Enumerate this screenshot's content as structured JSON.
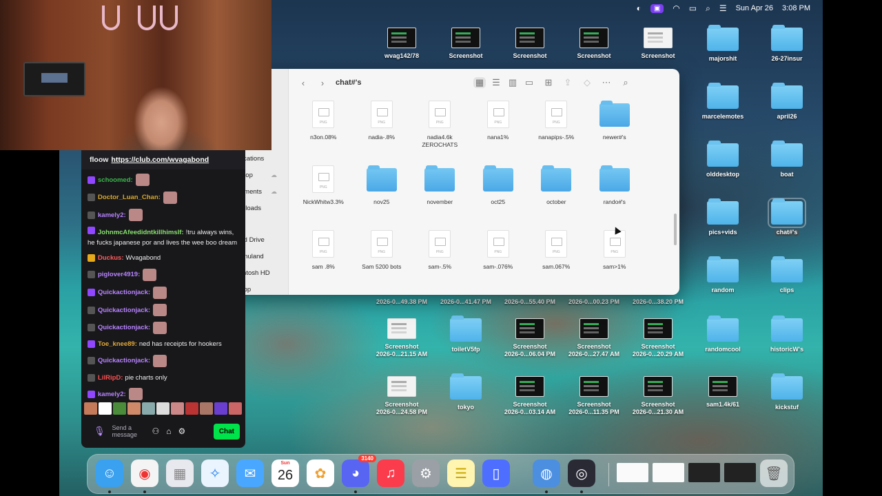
{
  "menubar": {
    "date": "Sun Apr 26",
    "time": "3:08 PM",
    "icons": [
      "globe-icon",
      "screen-record-icon",
      "wifi-icon",
      "battery-icon",
      "search-icon",
      "control-center-icon"
    ]
  },
  "desktop": {
    "items": [
      {
        "kind": "thumb",
        "label": "wvag142/78"
      },
      {
        "kind": "thumb",
        "label": "Screenshot"
      },
      {
        "kind": "thumb",
        "label": "Screenshot"
      },
      {
        "kind": "thumb",
        "label": "Screenshot"
      },
      {
        "kind": "thumb-light",
        "label": "Screenshot"
      },
      {
        "kind": "folder",
        "label": "majorshit"
      },
      {
        "kind": "folder",
        "label": "26-27insur"
      },
      {
        "kind": "folder",
        "label": "marcelemotes"
      },
      {
        "kind": "folder",
        "label": "april26"
      },
      {
        "kind": "folder",
        "label": "olddesktop"
      },
      {
        "kind": "folder",
        "label": "boat"
      },
      {
        "kind": "folder",
        "label": "pics+vids"
      },
      {
        "kind": "folder",
        "label": "chat#'s"
      },
      {
        "kind": "folder",
        "label": "random"
      },
      {
        "kind": "folder",
        "label": "clips"
      },
      {
        "kind": "timestamp",
        "label": "2026-0...49.38 PM"
      },
      {
        "kind": "timestamp",
        "label": "2026-0...41.47 PM"
      },
      {
        "kind": "timestamp",
        "label": "2026-0...55.40 PM"
      },
      {
        "kind": "timestamp",
        "label": "2026-0...00.23 PM"
      },
      {
        "kind": "timestamp",
        "label": "2026-0...38.20 PM"
      },
      {
        "kind": "thumb-light",
        "label": "Screenshot",
        "sub": "2026-0...21.15 AM"
      },
      {
        "kind": "folder",
        "label": "toiletV5fp"
      },
      {
        "kind": "thumb",
        "label": "Screenshot",
        "sub": "2026-0...06.04 PM"
      },
      {
        "kind": "thumb",
        "label": "Screenshot",
        "sub": "2026-0...27.47 AM"
      },
      {
        "kind": "thumb",
        "label": "Screenshot",
        "sub": "2026-0...20.29 AM"
      },
      {
        "kind": "folder",
        "label": "randomcool"
      },
      {
        "kind": "folder",
        "label": "historicW's"
      },
      {
        "kind": "thumb-light",
        "label": "Screenshot",
        "sub": "2026-0...24.58 PM"
      },
      {
        "kind": "folder",
        "label": "tokyo"
      },
      {
        "kind": "thumb",
        "label": "Screenshot",
        "sub": "2026-0...03.14 AM"
      },
      {
        "kind": "thumb",
        "label": "Screenshot",
        "sub": "2026-0...11.35 PM"
      },
      {
        "kind": "thumb",
        "label": "Screenshot",
        "sub": "2026-0...21.30 AM"
      },
      {
        "kind": "thumb",
        "label": "sam1.4k/61"
      },
      {
        "kind": "folder",
        "label": "kickstuf"
      },
      {
        "kind": "partial",
        "label": "PM"
      },
      {
        "kind": "partial",
        "label": "PM"
      },
      {
        "kind": "partial",
        "label": "PM"
      }
    ]
  },
  "finder": {
    "title": "chat#'s",
    "sidebar": {
      "items": [
        {
          "icon": "applications-icon",
          "label": "Applications"
        },
        {
          "icon": "desktop-icon",
          "label": "Desktop",
          "cloud": true
        },
        {
          "icon": "documents-icon",
          "label": "Documents",
          "cloud": true
        },
        {
          "icon": "downloads-icon",
          "label": "Downloads"
        }
      ],
      "locations_header": "Locations",
      "locations": [
        {
          "icon": "icloud-icon",
          "label": "iCloud Drive"
        },
        {
          "icon": "home-icon",
          "label": "justinnuland"
        },
        {
          "icon": "disk-icon",
          "label": "Macintosh HD"
        },
        {
          "icon": "airdrop-icon",
          "label": "AirDrop"
        }
      ]
    },
    "files": [
      {
        "kind": "png",
        "name": "n3on.08%"
      },
      {
        "kind": "png",
        "name": "nadia-.8%"
      },
      {
        "kind": "png",
        "name": "nadia4.6k ZEROCHATS"
      },
      {
        "kind": "png",
        "name": "nana1%"
      },
      {
        "kind": "png",
        "name": "nanapips-.5%"
      },
      {
        "kind": "folder",
        "name": "newer#'s"
      },
      {
        "kind": "png",
        "name": "NickWhitw3.3%"
      },
      {
        "kind": "folder",
        "name": "nov25"
      },
      {
        "kind": "folder",
        "name": "november"
      },
      {
        "kind": "folder",
        "name": "oct25"
      },
      {
        "kind": "folder",
        "name": "october"
      },
      {
        "kind": "folder",
        "name": "rando#'s"
      },
      {
        "kind": "png",
        "name": "sam .8%"
      },
      {
        "kind": "png",
        "name": "Sam 5200 bots"
      },
      {
        "kind": "png",
        "name": "sam-.5%"
      },
      {
        "kind": "png",
        "name": "sam-.076%"
      },
      {
        "kind": "png",
        "name": "sam.067%"
      },
      {
        "kind": "png",
        "name": "sam>1%"
      }
    ]
  },
  "chat": {
    "pinned_prefix": "floow",
    "pinned_link": "https://club.com/wvagabond",
    "messages": [
      {
        "user": "schoomed:",
        "color": "#3bb54a",
        "text": "",
        "emote": true
      },
      {
        "user": "Doctor_Luan_Chan:",
        "color": "#d9a92b",
        "text": "",
        "emote": true
      },
      {
        "user": "kamely2:",
        "color": "#b883ff",
        "text": "",
        "emote": true
      },
      {
        "user": "JohnmcAfeedidntkillhimslf:",
        "color": "#88e06d",
        "text": "!tru always wins, he fucks japanese por and lives the wee boo dream",
        "wrap": true
      },
      {
        "user": "Duckus:",
        "color": "#ff5a5a",
        "text": "Wvagabond"
      },
      {
        "user": "piglover4919:",
        "color": "#b883ff",
        "text": "",
        "emote": true
      },
      {
        "user": "Quickactionjack:",
        "color": "#b883ff",
        "text": "",
        "emote": true
      },
      {
        "user": "Quickactionjack:",
        "color": "#b883ff",
        "text": "",
        "emote": true
      },
      {
        "user": "Quickactionjack:",
        "color": "#b883ff",
        "text": "",
        "emote": true
      },
      {
        "user": "Toe_knee89:",
        "color": "#e0a93a",
        "text": "ned has receipts for hookers"
      },
      {
        "user": "Quickactionjack:",
        "color": "#b883ff",
        "text": "",
        "emote": true
      },
      {
        "user": "LilRipD:",
        "color": "#ff4f4f",
        "text": "pie charts only"
      },
      {
        "user": "kamely2:",
        "color": "#b883ff",
        "text": "",
        "emote": true
      }
    ],
    "input_placeholder": "Send a message",
    "send_label": "Chat"
  },
  "dock": {
    "apps": [
      {
        "name": "finder-icon",
        "bg": "#3aa0f0"
      },
      {
        "name": "chrome-icon",
        "bg": "#f4f4f4"
      },
      {
        "name": "launchpad-icon",
        "bg": "#e8e8ef"
      },
      {
        "name": "safari-icon",
        "bg": "#eaf4ff"
      },
      {
        "name": "mail-icon",
        "bg": "#4aa7ff"
      },
      {
        "name": "calendar-icon",
        "bg": "#ffffff"
      },
      {
        "name": "photos-icon",
        "bg": "#ffffff"
      },
      {
        "name": "discord-icon",
        "bg": "#5865f2"
      },
      {
        "name": "music-icon",
        "bg": "#fb3c4c"
      },
      {
        "name": "settings-icon",
        "bg": "#9aa0a6"
      },
      {
        "name": "notes-icon",
        "bg": "#fff4b0"
      },
      {
        "name": "iphone-mirroring-icon",
        "bg": "#4e6eff"
      },
      {
        "name": "app-icon",
        "bg": "#4c8fe0"
      },
      {
        "name": "obs-icon",
        "bg": "#2a2a35"
      }
    ],
    "calendar": {
      "month": "Sun",
      "day": "26"
    },
    "discord_badge": "3140"
  }
}
